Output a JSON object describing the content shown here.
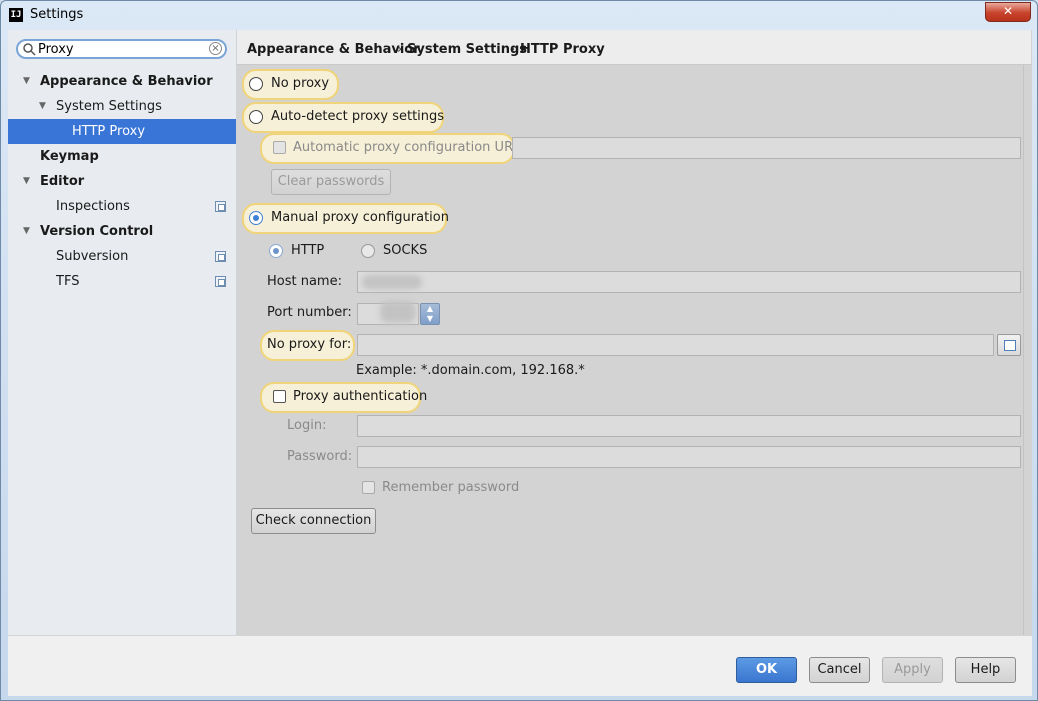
{
  "window": {
    "title": "Settings",
    "app_icon": "IJ"
  },
  "sidebar": {
    "search_value": "Proxy",
    "items": [
      {
        "label": "Appearance & Behavior"
      },
      {
        "label": "System Settings"
      },
      {
        "label": "HTTP Proxy"
      },
      {
        "label": "Keymap"
      },
      {
        "label": "Editor"
      },
      {
        "label": "Inspections"
      },
      {
        "label": "Version Control"
      },
      {
        "label": "Subversion"
      },
      {
        "label": "TFS"
      }
    ]
  },
  "breadcrumb": [
    "Appearance & Behavior",
    "System Settings",
    "HTTP Proxy"
  ],
  "breadcrumb_sep": "›",
  "proxy": {
    "no_proxy": "No proxy",
    "auto_detect": "Auto-detect proxy settings",
    "auto_config_url": "Automatic proxy configuration URL:",
    "clear_passwords": "Clear passwords",
    "manual": "Manual proxy configuration",
    "http": "HTTP",
    "socks": "SOCKS",
    "host_name": "Host name:",
    "port_number": "Port number:",
    "no_proxy_for": "No proxy for:",
    "example": "Example: *.domain.com, 192.168.*",
    "proxy_auth": "Proxy authentication",
    "login": "Login:",
    "password": "Password:",
    "remember_password": "Remember password",
    "check_connection": "Check connection"
  },
  "buttons": {
    "ok": "OK",
    "cancel": "Cancel",
    "apply": "Apply",
    "help": "Help"
  },
  "colors": {
    "selection": "#3875d7",
    "highlight_border": "#f0d47a",
    "ok_button": "#3a76cf"
  }
}
